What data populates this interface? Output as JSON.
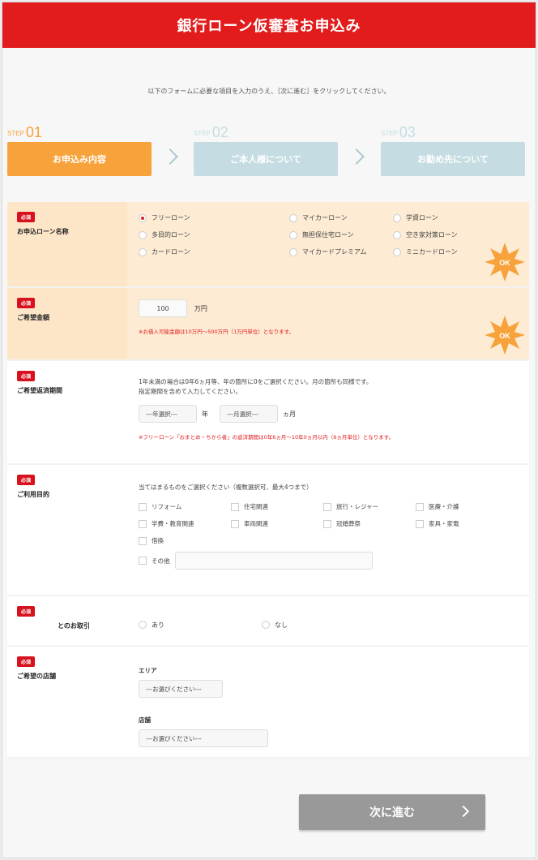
{
  "header": {
    "title": "銀行ローン仮審査お申込み"
  },
  "intro": "以下のフォームに必要な項目を入力のうえ、［次に進む］をクリックしてください。",
  "steps": [
    {
      "prefix": "STEP",
      "num": "01",
      "label": "お申込み内容"
    },
    {
      "prefix": "STEP",
      "num": "02",
      "label": "ご本人様について"
    },
    {
      "prefix": "STEP",
      "num": "03",
      "label": "お勤め先について"
    }
  ],
  "required_badge": "必須",
  "ok_mark": "OK",
  "loan_type": {
    "label": "お申込ローン名称",
    "options": [
      "フリーローン",
      "マイカーローン",
      "学資ローン",
      "多目的ローン",
      "無担保住宅ローン",
      "空き家対策ローン",
      "カードローン",
      "マイカードプレミアム",
      "ミニカードローン"
    ],
    "selected": "フリーローン"
  },
  "amount": {
    "label": "ご希望金額",
    "value": "100",
    "unit": "万円",
    "note": "※お借入可能金額は10万円～500万円（1万円単位）となります。"
  },
  "period": {
    "label": "ご希望返済期間",
    "desc1": "1年未満の場合は0年6ヵ月等、年の箇所に0をご選択ください。月の箇所も同様です。",
    "desc2": "指定期間を含めて入力してください。",
    "year_placeholder": "---年選択---",
    "year_unit": "年",
    "month_placeholder": "---月選択---",
    "month_unit": "ヵ月",
    "note": "※フリーローン「おまとめ・ちから者」の返済期間は0年6ヵ月～10年0ヵ月以内（6ヵ月単位）となります。"
  },
  "purpose": {
    "label": "ご利用目的",
    "desc": "当てはまるものをご選択ください（複数選択可、最大4つまで）",
    "options": [
      "リフォーム",
      "住宅関連",
      "旅行・レジャー",
      "医療・介護",
      "学費・教育関連",
      "車両関連",
      "冠婚葬祭",
      "家具・家電",
      "借換"
    ],
    "other_label": "その他"
  },
  "transaction": {
    "label": "とのお取引",
    "options": [
      "あり",
      "なし"
    ]
  },
  "branch": {
    "label": "ご希望の店舗",
    "area_label": "エリア",
    "area_placeholder": "---お選びください---",
    "store_label": "店舗",
    "store_placeholder": "---お選びください---"
  },
  "next_button": "次に進む"
}
